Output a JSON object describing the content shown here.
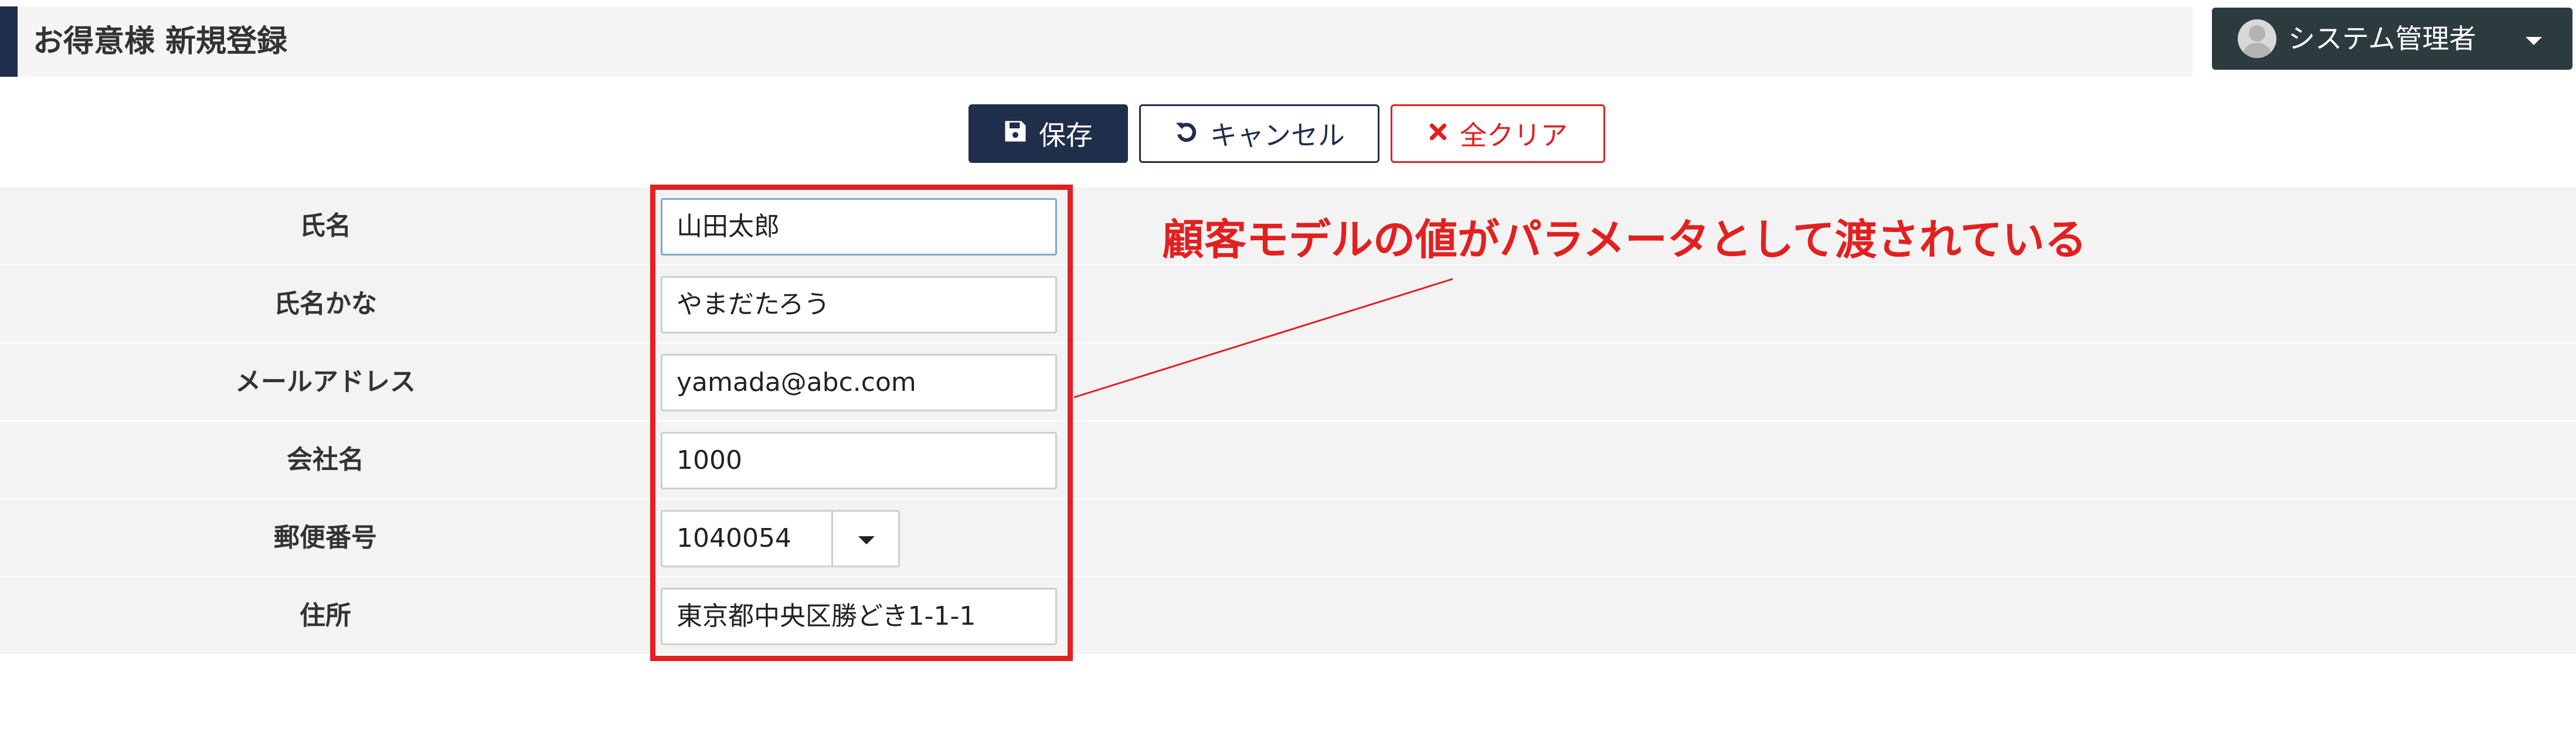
{
  "header": {
    "title": "お得意様 新規登録",
    "user_name": "システム管理者",
    "accent_color": "#1f2e4a"
  },
  "toolbar": {
    "save_label": "保存",
    "cancel_label": "キャンセル",
    "clear_label": "全クリア"
  },
  "form": {
    "rows": [
      {
        "label": "氏名",
        "value": "山田太郎"
      },
      {
        "label": "氏名かな",
        "value": "やまだたろう"
      },
      {
        "label": "メールアドレス",
        "value": "yamada@abc.com"
      },
      {
        "label": "会社名",
        "value": "1000"
      },
      {
        "label": "郵便番号",
        "value": "1040054"
      },
      {
        "label": "住所",
        "value": "東京都中央区勝どき1-1-1"
      }
    ]
  },
  "annotation": {
    "text": "顧客モデルの値がパラメータとして渡されている",
    "color": "#e22020"
  },
  "icons": {
    "save": "floppy-disk-icon",
    "cancel": "undo-icon",
    "clear": "close-icon",
    "dropdown": "caret-down-icon",
    "user": "user-avatar-icon"
  }
}
